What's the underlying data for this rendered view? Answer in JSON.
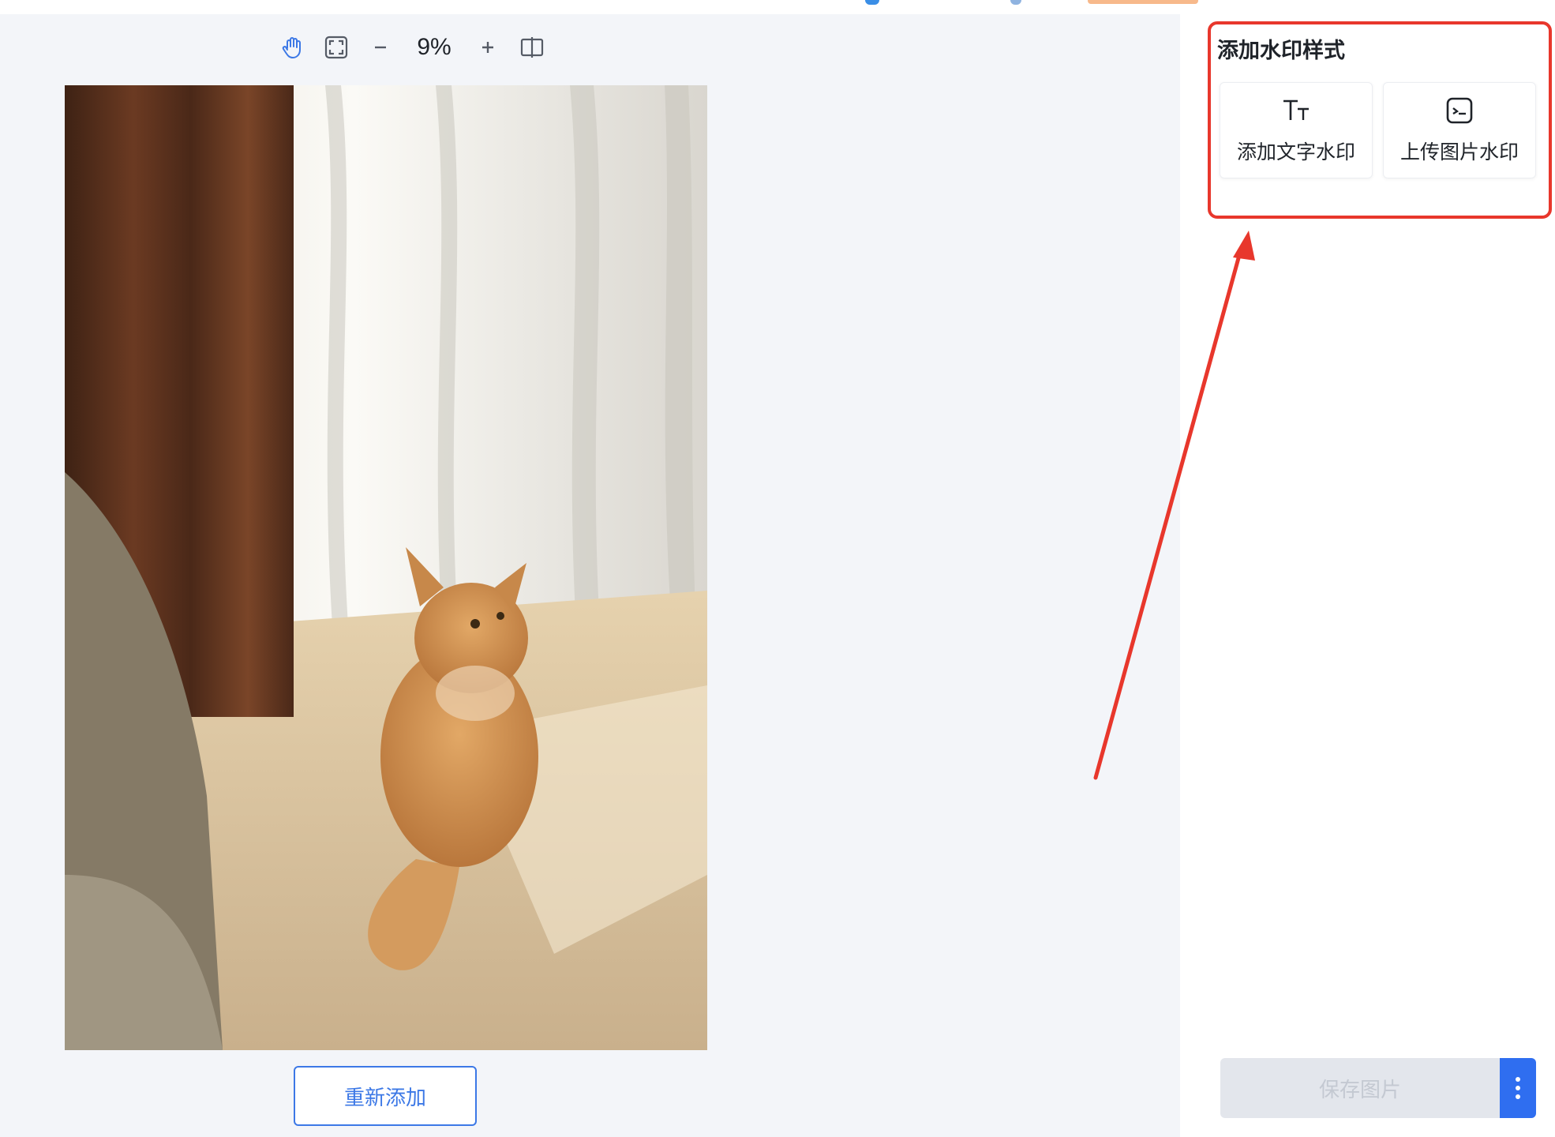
{
  "toolbar": {
    "zoom_level": "9%",
    "icons": [
      "hand-pan-icon",
      "fit-screen-icon",
      "zoom-out-icon",
      "zoom-in-icon",
      "compare-icon"
    ]
  },
  "canvas": {
    "re_add_label": "重新添加"
  },
  "panel": {
    "title": "添加水印样式",
    "options": [
      {
        "label": "添加文字水印",
        "icon": "text-tt-icon"
      },
      {
        "label": "上传图片水印",
        "icon": "image-upload-icon"
      }
    ],
    "save_label": "保存图片",
    "more_icon": "more-vertical-icon"
  },
  "colors": {
    "accent": "#3c78e6",
    "annotation_red": "#e8372c",
    "primary_button": "#2f6ef0",
    "disabled_bg": "#e3e6ec"
  }
}
